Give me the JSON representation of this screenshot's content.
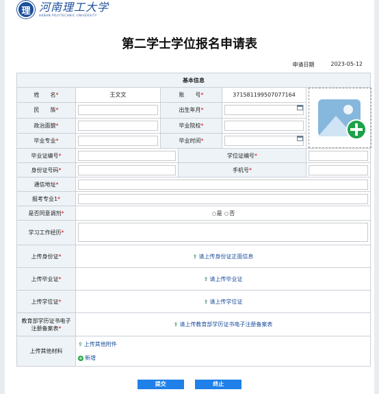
{
  "header": {
    "logo_mark": "理",
    "logo_cn": "河南理工大学",
    "logo_en": "HENAN POLYTECHNIC UNIVERSITY"
  },
  "title": "第二学士学位报名申请表",
  "apply_date": {
    "label": "申请日期",
    "value": "2023-05-12"
  },
  "section": "基本信息",
  "labels": {
    "name": "姓　　名",
    "account": "账　　号",
    "ethnicity": "民　　族",
    "birth": "出生年月",
    "politics": "政治面貌",
    "grad_school": "毕业院校",
    "major": "毕业专业",
    "grad_time": "毕业时间",
    "diploma_no": "毕业证编号",
    "degree_no": "学位证编号",
    "id_no": "身份证号码",
    "phone": "手机号",
    "address": "通信地址",
    "apply_major": "报考专业1",
    "adjust": "是否同意调剂",
    "experience": "学习工作经历",
    "upload_id": "上传身份证",
    "upload_diploma": "上传毕业证",
    "upload_degree": "上传学位证",
    "upload_moe": "教育部学历证书电子注册备案表",
    "upload_other": "上传其他材料"
  },
  "required_mark": "*",
  "values": {
    "name": "王文文",
    "account": "371581199507077164"
  },
  "adjust_options": [
    "是",
    "否"
  ],
  "uploads": {
    "id": "请上传身份证正面信息",
    "diploma": "请上传毕业证",
    "degree": "请上传学位证",
    "moe": "请上传教育部学历证书电子注册备案表",
    "other": "上传其他附件",
    "add": "新增"
  },
  "buttons": {
    "submit": "提交",
    "stop": "终止"
  },
  "colors": {
    "accent": "#1e80e8",
    "label_bg": "#edf3f7",
    "required": "#dd0000",
    "brand": "#1d4f9c"
  }
}
